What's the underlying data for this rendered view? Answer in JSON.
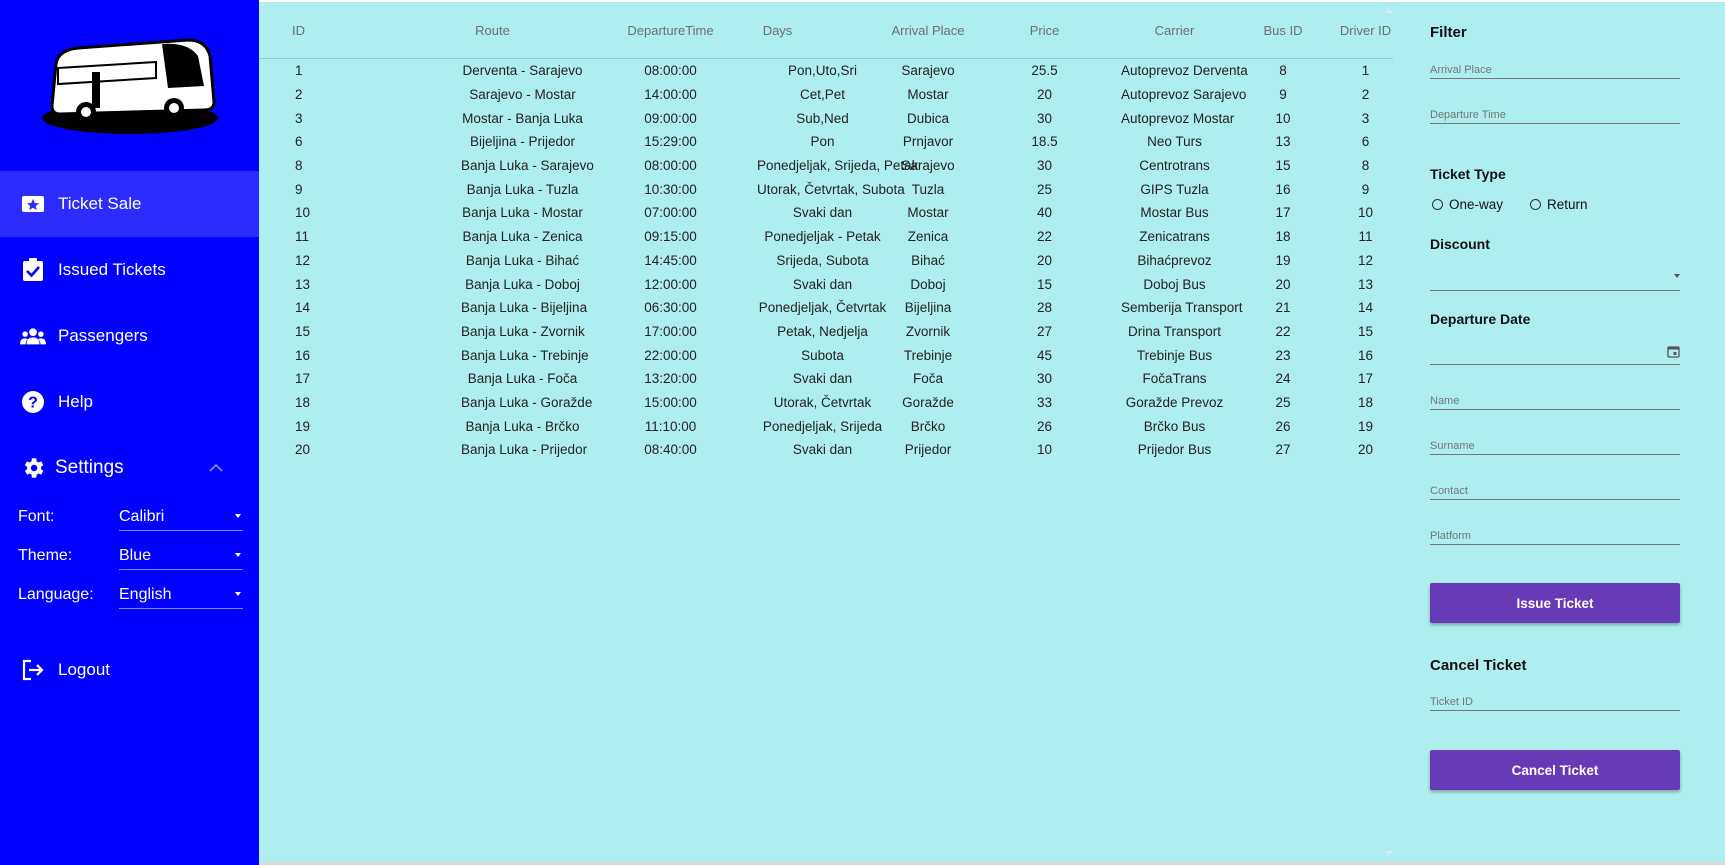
{
  "sidebar": {
    "nav": [
      {
        "label": "Ticket Sale",
        "icon": "ticket-star-icon",
        "active": true
      },
      {
        "label": "Issued Tickets",
        "icon": "clipboard-check-icon",
        "active": false
      },
      {
        "label": "Passengers",
        "icon": "people-icon",
        "active": false
      },
      {
        "label": "Help",
        "icon": "help-circle-icon",
        "active": false
      }
    ],
    "settings": {
      "label": "Settings",
      "font": {
        "label": "Font:",
        "value": "Calibri"
      },
      "theme": {
        "label": "Theme:",
        "value": "Blue"
      },
      "language": {
        "label": "Language:",
        "value": "English"
      }
    },
    "logout": "Logout"
  },
  "table": {
    "headers": [
      "ID",
      "Route",
      "DepartureTime",
      "Days",
      "Arrival Place",
      "Price",
      "Carrier",
      "Bus ID",
      "Driver ID"
    ],
    "rows": [
      [
        "1",
        "Derventa - Sarajevo",
        "08:00:00",
        "Pon,Uto,Sri",
        "Sarajevo",
        "25.5",
        "Autoprevoz Derventa",
        "8",
        "1"
      ],
      [
        "2",
        "Sarajevo - Mostar",
        "14:00:00",
        "Cet,Pet",
        "Mostar",
        "20",
        "Autoprevoz Sarajevo",
        "9",
        "2"
      ],
      [
        "3",
        "Mostar - Banja Luka",
        "09:00:00",
        "Sub,Ned",
        "Dubica",
        "30",
        "Autoprevoz Mostar",
        "10",
        "3"
      ],
      [
        "6",
        "Bijeljina - Prijedor",
        "15:29:00",
        "Pon",
        "Prnjavor",
        "18.5",
        "Neo Turs",
        "13",
        "6"
      ],
      [
        "8",
        "Banja Luka - Sarajevo",
        "08:00:00",
        "Ponedjeljak, Srijeda, Petak",
        "Sarajevo",
        "30",
        "Centrotrans",
        "15",
        "8"
      ],
      [
        "9",
        "Banja Luka - Tuzla",
        "10:30:00",
        "Utorak, Četvrtak, Subota",
        "Tuzla",
        "25",
        "GIPS Tuzla",
        "16",
        "9"
      ],
      [
        "10",
        "Banja Luka - Mostar",
        "07:00:00",
        "Svaki dan",
        "Mostar",
        "40",
        "Mostar Bus",
        "17",
        "10"
      ],
      [
        "11",
        "Banja Luka - Zenica",
        "09:15:00",
        "Ponedjeljak - Petak",
        "Zenica",
        "22",
        "Zenicatrans",
        "18",
        "11"
      ],
      [
        "12",
        "Banja Luka - Bihać",
        "14:45:00",
        "Srijeda, Subota",
        "Bihać",
        "20",
        "Bihaćprevoz",
        "19",
        "12"
      ],
      [
        "13",
        "Banja Luka - Doboj",
        "12:00:00",
        "Svaki dan",
        "Doboj",
        "15",
        "Doboj Bus",
        "20",
        "13"
      ],
      [
        "14",
        "Banja Luka - Bijeljina",
        "06:30:00",
        "Ponedjeljak, Četvrtak",
        "Bijeljina",
        "28",
        "Semberija Transport",
        "21",
        "14"
      ],
      [
        "15",
        "Banja Luka - Zvornik",
        "17:00:00",
        "Petak, Nedjelja",
        "Zvornik",
        "27",
        "Drina Transport",
        "22",
        "15"
      ],
      [
        "16",
        "Banja Luka - Trebinje",
        "22:00:00",
        "Subota",
        "Trebinje",
        "45",
        "Trebinje Bus",
        "23",
        "16"
      ],
      [
        "17",
        "Banja Luka - Foča",
        "13:20:00",
        "Svaki dan",
        "Foča",
        "30",
        "FočaTrans",
        "24",
        "17"
      ],
      [
        "18",
        "Banja Luka - Goražde",
        "15:00:00",
        "Utorak, Četvrtak",
        "Goražde",
        "33",
        "Goražde Prevoz",
        "25",
        "18"
      ],
      [
        "19",
        "Banja Luka - Brčko",
        "11:10:00",
        "Ponedjeljak, Srijeda",
        "Brčko",
        "26",
        "Brčko Bus",
        "26",
        "19"
      ],
      [
        "20",
        "Banja Luka - Prijedor",
        "08:40:00",
        "Svaki dan",
        "Prijedor",
        "10",
        "Prijedor Bus",
        "27",
        "20"
      ]
    ]
  },
  "filter": {
    "title": "Filter",
    "arrival_place_placeholder": "Arrival Place",
    "departure_time_placeholder": "Departure Time",
    "ticket_type_title": "Ticket Type",
    "one_way": "One-way",
    "return": "Return",
    "discount_title": "Discount",
    "departure_date_title": "Departure Date",
    "name_placeholder": "Name",
    "surname_placeholder": "Surname",
    "contact_placeholder": "Contact",
    "platform_placeholder": "Platform",
    "issue_button": "Issue Ticket",
    "cancel_title": "Cancel Ticket",
    "ticket_id_placeholder": "Ticket ID",
    "cancel_button": "Cancel Ticket"
  },
  "colors": {
    "sidebar_bg": "#0000ff",
    "active_item_bg": "#2c2cff",
    "content_bg": "#afeeee",
    "button_bg": "#673ab7"
  }
}
